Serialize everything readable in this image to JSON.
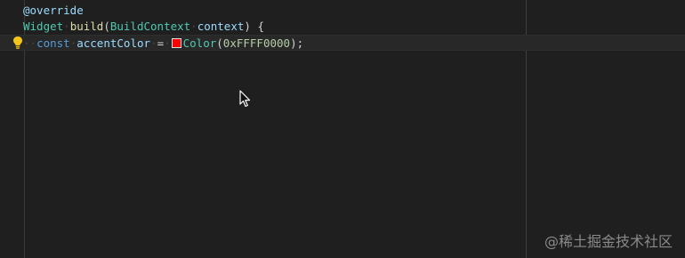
{
  "editor": {
    "line1": {
      "decorator": "@override"
    },
    "line2": {
      "return_type": "Widget",
      "method": "build",
      "open_paren": "(",
      "param_type": "BuildContext",
      "param_name": "context",
      "close_brace": ") {"
    },
    "line3": {
      "keyword": "const",
      "var_name": "accentColor",
      "equals": "=",
      "ctor": "Color",
      "open_paren": "(",
      "hex": "0xFFFF0000",
      "close": ");"
    },
    "color_swatch_hex": "#ff0000",
    "lightbulb_icon": "lightbulb-icon",
    "mouse_pointer_icon": "mouse-pointer-icon"
  },
  "watermark": {
    "text": "@稀土掘金技术社区"
  }
}
